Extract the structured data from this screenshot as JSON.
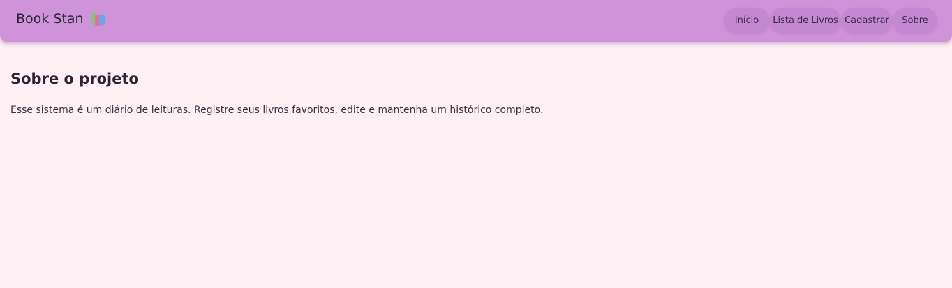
{
  "navbar": {
    "brand": "Book Stan",
    "brand_icon": "books-icon",
    "background_color": "#ce93d8",
    "links": [
      {
        "label": "Início"
      },
      {
        "label": "Lista de Livros"
      },
      {
        "label": "Cadastrar"
      },
      {
        "label": "Sobre"
      }
    ]
  },
  "main": {
    "title": "Sobre o projeto",
    "description": "Esse sistema é um diário de leituras. Registre seus livros favoritos, edite e mantenha um histórico completo."
  },
  "colors": {
    "page_background": "#fff0f5",
    "navbar": "#ce93d8",
    "nav_button": "#c487d1"
  }
}
